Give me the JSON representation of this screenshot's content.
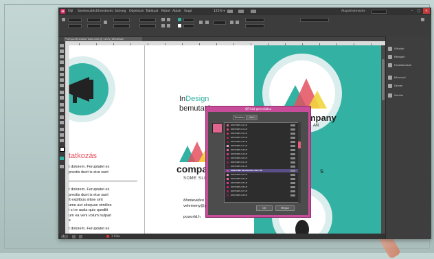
{
  "app": {
    "logo": "Id",
    "menu": [
      "Fájl",
      "Szerkesztés",
      "Elrendezés",
      "Szöveg",
      "Objektum",
      "Táblázat",
      "Nézet",
      "Ablak",
      "Súgó"
    ],
    "zoom": "125% ▾",
    "workspace": "Alapértelmezés",
    "window_buttons": [
      "–",
      "□",
      "✕"
    ]
  },
  "document": {
    "tab_title": "*Cimpa-Minesotal Tools.indd @ 125% [Átfedések"
  },
  "panels": [
    {
      "label": "Oldalak"
    },
    {
      "label": "Rétegek"
    },
    {
      "label": "Hivatkozások"
    },
    {
      "label": "Körvonal"
    },
    {
      "label": "Színek"
    },
    {
      "label": "Színtár"
    }
  ],
  "pages": {
    "left": {
      "heading": "tatkozás",
      "para1": [
        "t dolorem. Feruptatet ex",
        "prestis dunt is etur sunt"
      ],
      "para2": [
        "t dolorem. Feruptatet ex",
        "prestis dunt is etur sunt",
        "it explibus sitiae sint",
        "ume aut elisquae similles",
        "i si re auda quis quoditi",
        "um ea veni volum nulpari",
        "s"
      ],
      "para3": "t dolorem. Feruptatet ex"
    },
    "middle": {
      "title_in": "In",
      "title_design": "Design",
      "title_line2": "bemutató",
      "company": "compa",
      "slogan": "SOME SLO",
      "contact": [
        "Montevideo",
        "velemeny@pcv",
        "pcworld.h"
      ]
    },
    "right": {
      "company": "ompany",
      "slogan": "AN",
      "fragment": "s"
    }
  },
  "dialog": {
    "title": "QR-kód generálása",
    "tabs": [
      "Tartalom",
      "Szín"
    ],
    "swatches": [
      {
        "name": "PANTONE 212 UP",
        "color": "#e0648f"
      },
      {
        "name": "PANTONE 213 UP",
        "color": "#d8457c"
      },
      {
        "name": "PANTONE 214 UP",
        "color": "#c7336d"
      },
      {
        "name": "PANTONE 215 UP",
        "color": "#a52a5c"
      },
      {
        "name": "PANTONE 216 UP",
        "color": "#7e2349"
      },
      {
        "name": "PANTONE 217 UP",
        "color": "#e9a8c8"
      },
      {
        "name": "PANTONE 218 UP",
        "color": "#d96aa8"
      },
      {
        "name": "PANTONE 219 UP",
        "color": "#d6388a"
      },
      {
        "name": "PANTONE 220 UP",
        "color": "#a4226b"
      },
      {
        "name": "PANTONE 221 UP",
        "color": "#8d1f5c"
      },
      {
        "name": "PANTONE 222 UP",
        "color": "#6b1c45"
      },
      {
        "name": "PANTONE Rhodamine Red UP",
        "color": "#e23d9a"
      },
      {
        "name": "PANTONE 223 UP",
        "color": "#ec8fc1"
      },
      {
        "name": "PANTONE 224 UP",
        "color": "#e56aaf"
      },
      {
        "name": "PANTONE 225 UP",
        "color": "#d83a93"
      },
      {
        "name": "PANTONE 226 UP",
        "color": "#cc1f7e"
      },
      {
        "name": "PANTONE 227 UP",
        "color": "#a91b6a"
      },
      {
        "name": "PANTONE 228 UP",
        "color": "#881c57"
      }
    ],
    "selected_index": 11,
    "ok": "OK",
    "cancel": "Mégse"
  },
  "status": {
    "page": "1",
    "errors": "1 hiba"
  },
  "colors": {
    "teal": "#33b2a3",
    "accent_red": "#e4505f",
    "dialog_frame": "#c74d9a"
  }
}
